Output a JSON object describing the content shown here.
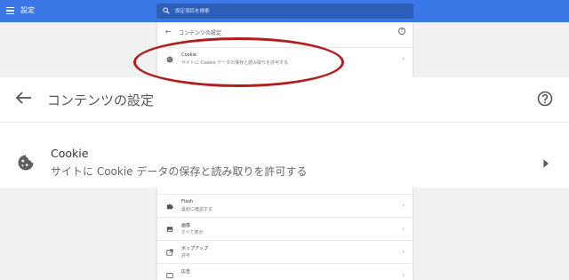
{
  "header": {
    "app_title": "設定",
    "search_placeholder": "設定項目を検索"
  },
  "background_card": {
    "title": "コンテンツの設定",
    "help_glyph": "?",
    "back_glyph": "←",
    "rows": [
      {
        "title": "Cookie",
        "subtitle": "サイトに Cookie データの保存と読み取りを許可する",
        "icon": "cookie-icon"
      },
      {
        "title": "Flash",
        "subtitle": "最初に確認する",
        "icon": "puzzle-icon"
      },
      {
        "title": "画像",
        "subtitle": "すべて表示",
        "icon": "image-icon"
      },
      {
        "title": "ポップアップ",
        "subtitle": "許可",
        "icon": "popup-icon"
      },
      {
        "title": "広告",
        "subtitle": "",
        "icon": "ads-icon"
      }
    ],
    "arrow_glyph": "›"
  },
  "zoom_panel": {
    "title": "コンテンツの設定",
    "cookie_title": "Cookie",
    "cookie_description": "サイトに Cookie データの保存と読み取りを許可する"
  },
  "colors": {
    "accent": "#3b78e7",
    "search_bg": "#2d5fb8",
    "annotation": "#b21d1d"
  }
}
